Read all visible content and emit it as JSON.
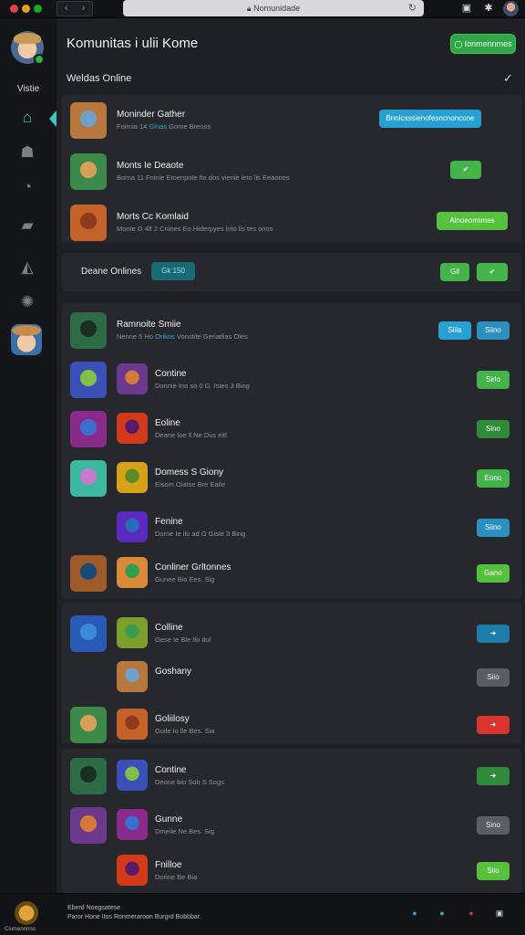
{
  "window": {
    "url": "Nomunidade",
    "nav_arrows": "‹ ›",
    "colors": {
      "close": "#e0443e",
      "minimize": "#dea123",
      "maximize": "#1aab29"
    }
  },
  "sidebar": {
    "profile_label": "Vistie",
    "items": [
      {
        "icon": "home-icon",
        "glyph": "⌂",
        "active": true
      },
      {
        "icon": "house-icon",
        "glyph": "☗",
        "active": false
      },
      {
        "icon": "compass-icon",
        "glyph": "◔",
        "active": false
      },
      {
        "icon": "chat-icon",
        "glyph": "▰",
        "active": false
      },
      {
        "icon": "flag-icon",
        "glyph": "◭",
        "active": false
      },
      {
        "icon": "settings-icon",
        "glyph": "✺",
        "active": false
      }
    ]
  },
  "header": {
    "title": "Komunitas i ulii Kome",
    "action_button": "Ionmennmes",
    "section": "Weldas Online"
  },
  "featured": [
    {
      "name": "Moninder Gather",
      "sub_pre": "Foirnia 14",
      "sub_hl": "Ginas",
      "sub_post": "Gome Brenss",
      "button": "Bnnicsssienofesncnoncone",
      "button_color": "cyan"
    },
    {
      "name": "Monts Ie Deaote",
      "sub_pre": "Borna 11 Fninie",
      "sub_hl": "",
      "sub_post": "Etoenpnte fio dos vienie ieto lis Eeaonos",
      "button": "✔",
      "button_color": "green"
    },
    {
      "name": "Morts Cc Komlaid",
      "sub_pre": "Monte G 4lf 2 Cnines",
      "sub_hl": "",
      "sub_post": "Eo Hiderpyes into lis tes onos",
      "button": "Alnoeormmes",
      "button_color": "lime"
    }
  ],
  "online_bar": {
    "label": "Deane Onlines",
    "chip": "Gk  150",
    "btn1": "Gil",
    "btn2": "✔"
  },
  "groups": [
    {
      "rows": [
        {
          "name": "Ramnoite Smiie",
          "sub_pre": "Nenne 5 Ho",
          "sub_hl": "Orikos",
          "sub_post": "Vonstite Geriatlias Oles",
          "buttons": [
            {
              "label": "Siila",
              "color": "cyan"
            },
            {
              "label": "Siino",
              "color": "blue"
            }
          ],
          "double": false
        },
        {
          "name": "Contine",
          "sub_pre": "Donnie Ino so 0 G. Istes 3 Bing",
          "sub_hl": "",
          "sub_post": "",
          "buttons": [
            {
              "label": "Sirlo",
              "color": "green"
            }
          ],
          "double": true
        },
        {
          "name": "Eoline",
          "sub_pre": "Deane Ioe ll Ne Dus eitl",
          "sub_hl": "",
          "sub_post": "",
          "buttons": [
            {
              "label": "Sino",
              "color": "darkgreen"
            }
          ],
          "double": true
        },
        {
          "name": "Domess S Giony",
          "sub_pre": "Eisom Oiatse Bre Eaile",
          "sub_hl": "",
          "sub_post": "",
          "buttons": [
            {
              "label": "Eono",
              "color": "green"
            }
          ],
          "double": true
        },
        {
          "name": "Fenine",
          "sub_pre": "Dorne Ie ilo ad G Gisle 3 Bing",
          "sub_hl": "",
          "sub_post": "",
          "buttons": [
            {
              "label": "Siino",
              "color": "blue"
            }
          ],
          "double": false
        },
        {
          "name": "Conliner Grltonnes",
          "sub_pre": "Gunee Bio Ees. Sig",
          "sub_hl": "",
          "sub_post": "",
          "buttons": [
            {
              "label": "Gano",
              "color": "lime"
            }
          ],
          "double": true
        }
      ]
    },
    {
      "rows": [
        {
          "name": "Colline",
          "sub_pre": "Gese Ie Ble Ilo dul",
          "sub_hl": "",
          "sub_post": "",
          "buttons": [
            {
              "label": "➜",
              "color": "teal"
            }
          ],
          "double": true
        },
        {
          "name": "Goshany",
          "sub_pre": "",
          "sub_hl": "",
          "sub_post": "",
          "buttons": [
            {
              "label": "Siio",
              "color": "gray"
            }
          ],
          "double": false
        },
        {
          "name": "Goliilosy",
          "sub_pre": "Goile Io lle Bes. Sia",
          "sub_hl": "",
          "sub_post": "",
          "buttons": [
            {
              "label": "➜",
              "color": "red"
            }
          ],
          "double": true
        }
      ]
    },
    {
      "rows": [
        {
          "name": "Contine",
          "sub_pre": "Deone bio Sob S Sogs",
          "sub_hl": "",
          "sub_post": "",
          "buttons": [
            {
              "label": "➜",
              "color": "darkgreen"
            }
          ],
          "double": true
        },
        {
          "name": "Gunne",
          "sub_pre": "Dmeile Ne Bes. Sig",
          "sub_hl": "",
          "sub_post": "",
          "buttons": [
            {
              "label": "Sino",
              "color": "gray"
            }
          ],
          "double": true
        },
        {
          "name": "Fnilloe",
          "sub_pre": "Dorine Be Bia",
          "sub_hl": "",
          "sub_post": "",
          "buttons": [
            {
              "label": "Siio",
              "color": "lime"
            }
          ],
          "double": false
        }
      ]
    }
  ],
  "footer": {
    "label": "Ciumennnno",
    "line1": "Eberd Noegsatese",
    "line2": "Paror Hone Itos Ronmeraroon Burgrd Bobbbar.",
    "icons": [
      {
        "icon": "home-icon",
        "glyph": "●",
        "color": "#27a0d4"
      },
      {
        "icon": "compass-icon",
        "glyph": "●",
        "color": "#2bb6a4"
      },
      {
        "icon": "notification-icon",
        "glyph": "●",
        "color": "#d9352e"
      },
      {
        "icon": "window-icon",
        "glyph": "▣",
        "color": "#c9cacd"
      }
    ]
  }
}
